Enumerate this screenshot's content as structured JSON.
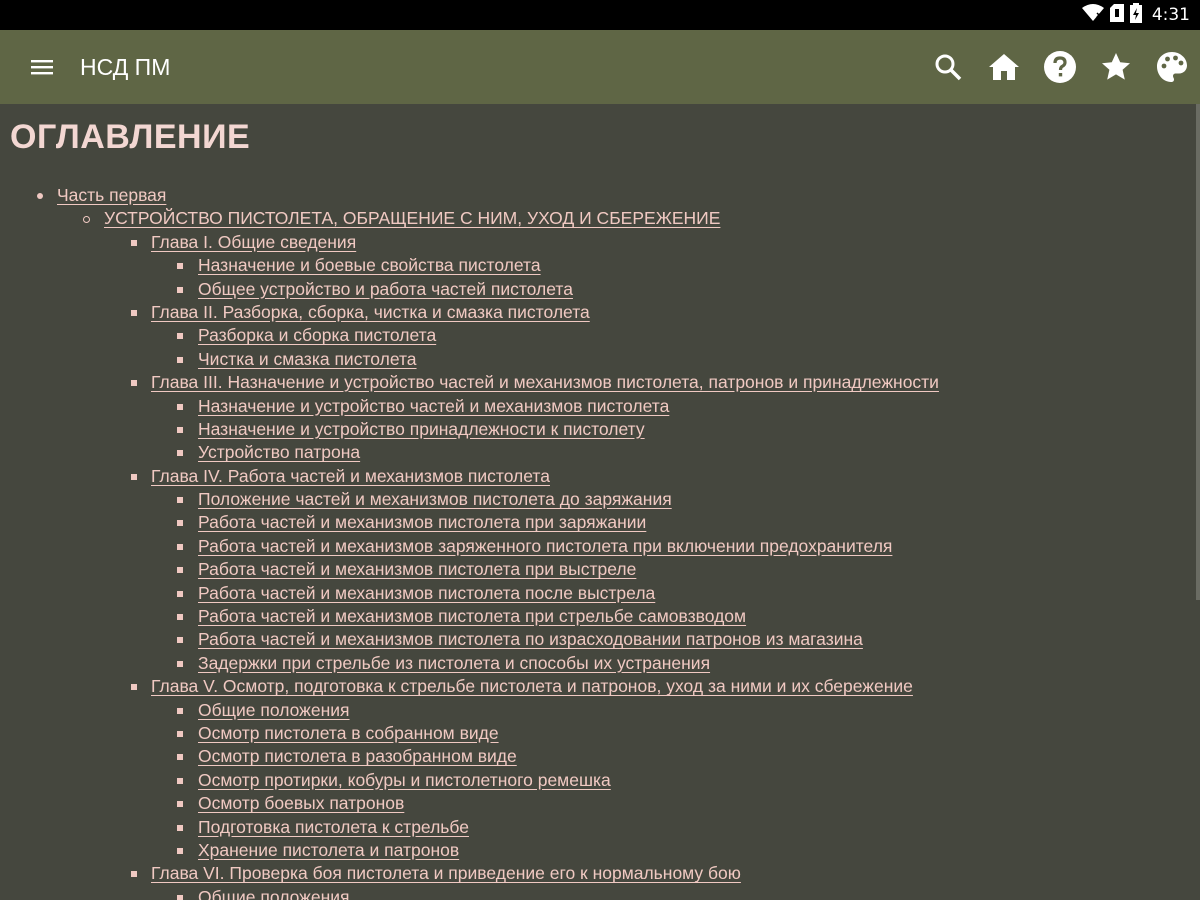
{
  "status_bar": {
    "time": "4:31",
    "icons": [
      "wifi-icon",
      "no-sim-icon",
      "battery-icon"
    ]
  },
  "toolbar": {
    "title": "НСД ПМ",
    "icons": [
      "menu-icon",
      "search-icon",
      "home-icon",
      "help-icon",
      "star-icon",
      "palette-icon"
    ]
  },
  "colors": {
    "status_bar": "#000000",
    "toolbar": "#5f6645",
    "background": "#45473e",
    "title": "#f3d7d2",
    "link": "#f0c9c2"
  },
  "content": {
    "heading": "ОГЛАВЛЕНИЕ",
    "toc": [
      {
        "level": 1,
        "text": "Часть первая"
      },
      {
        "level": 2,
        "text": "УСТРОЙСТВО ПИСТОЛЕТА, ОБРАЩЕНИЕ С НИМ, УХОД И СБЕРЕЖЕНИЕ"
      },
      {
        "level": 3,
        "text": "Глава I. Общие сведения"
      },
      {
        "level": 4,
        "text": "Назначение и боевые свойства пистолета"
      },
      {
        "level": 4,
        "text": "Общее устройство и работа частей пистолета"
      },
      {
        "level": 3,
        "text": "Глава II. Разборка, сборка, чистка и смазка пистолета"
      },
      {
        "level": 4,
        "text": "Разборка и сборка пистолета"
      },
      {
        "level": 4,
        "text": "Чистка и смазка пистолета"
      },
      {
        "level": 3,
        "text": "Глава III. Назначение и устройство частей и механизмов пистолета, патронов и принадлежности"
      },
      {
        "level": 4,
        "text": "Назначение и устройство частей и механизмов пистолета"
      },
      {
        "level": 4,
        "text": "Назначение и устройство принадлежности к пистолету"
      },
      {
        "level": 4,
        "text": "Устройство патрона"
      },
      {
        "level": 3,
        "text": "Глава IV. Работа частей и механизмов пистолета"
      },
      {
        "level": 4,
        "text": "Положение частей и механизмов пистолета до заряжания"
      },
      {
        "level": 4,
        "text": "Работа частей и механизмов пистолета при заряжании"
      },
      {
        "level": 4,
        "text": "Работа частей и механизмов заряженного пистолета при включении предохранителя"
      },
      {
        "level": 4,
        "text": "Работа частей и механизмов пистолета при выстреле"
      },
      {
        "level": 4,
        "text": "Работа частей и механизмов пистолета после выстрела"
      },
      {
        "level": 4,
        "text": "Работа частей и механизмов пистолета при стрельбе самовзводом"
      },
      {
        "level": 4,
        "text": "Работа частей и механизмов пистолета по израсходовании патронов из магазина"
      },
      {
        "level": 4,
        "text": "Задержки при стрельбе из пистолета и способы их устранения"
      },
      {
        "level": 3,
        "text": "Глава V. Осмотр, подготовка к стрельбе пистолета и патронов, уход за ними и их сбережение"
      },
      {
        "level": 4,
        "text": "Общие положения"
      },
      {
        "level": 4,
        "text": "Осмотр пистолета в собранном виде"
      },
      {
        "level": 4,
        "text": "Осмотр пистолета в разобранном виде"
      },
      {
        "level": 4,
        "text": "Осмотр протирки, кобуры и пистолетного ремешка"
      },
      {
        "level": 4,
        "text": "Осмотр боевых патронов"
      },
      {
        "level": 4,
        "text": "Подготовка пистолета к стрельбе"
      },
      {
        "level": 4,
        "text": "Хранение пистолета и патронов"
      },
      {
        "level": 3,
        "text": "Глава VI. Проверка боя пистолета и приведение его к нормальному бою"
      },
      {
        "level": 4,
        "text": "Общие положения"
      }
    ]
  }
}
